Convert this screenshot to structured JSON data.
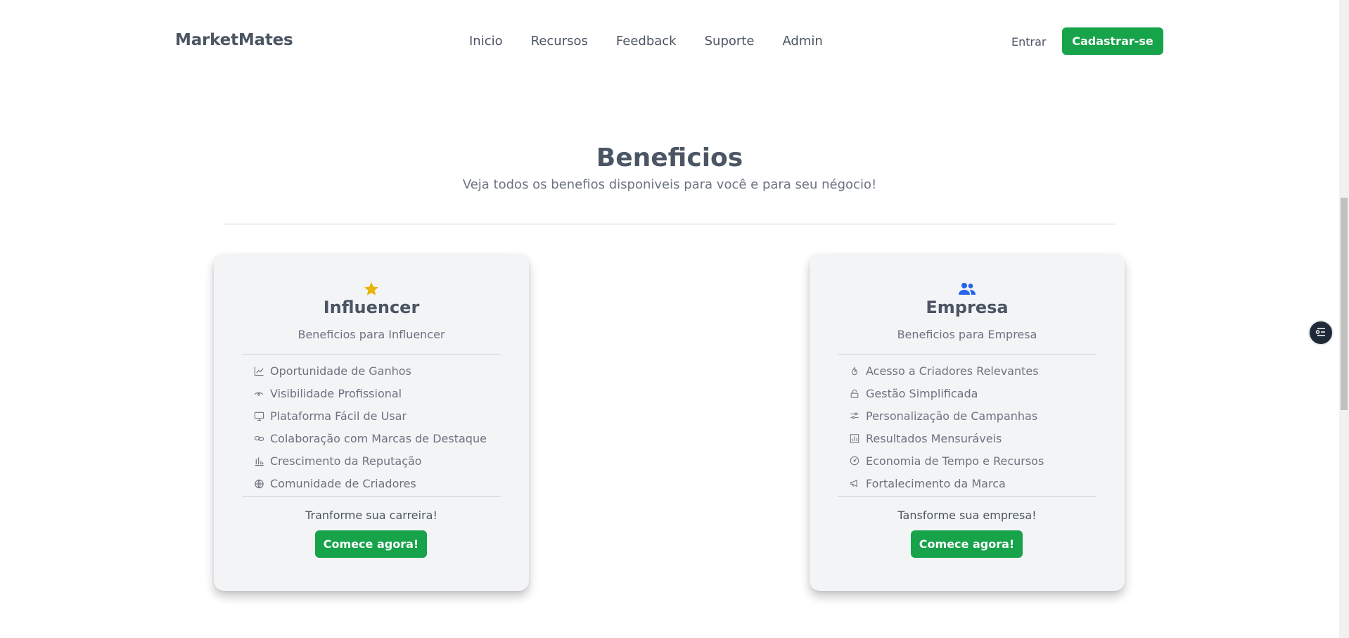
{
  "header": {
    "brand": "MarketMates",
    "nav": [
      "Inicio",
      "Recursos",
      "Feedback",
      "Suporte",
      "Admin"
    ],
    "login_label": "Entrar",
    "signup_label": "Cadastrar-se"
  },
  "section": {
    "title": "Beneficios",
    "subtitle": "Veja todos os benefios disponiveis para você e para seu négocio!"
  },
  "cards": [
    {
      "icon": "star-icon",
      "title": "Influencer",
      "subtitle": "Beneficios para Influencer",
      "items": [
        {
          "icon": "line-chart-icon",
          "label": "Oportunidade de Ganhos"
        },
        {
          "icon": "eye-icon",
          "label": "Visibilidade Profissional"
        },
        {
          "icon": "monitor-icon",
          "label": "Plataforma Fácil de Usar"
        },
        {
          "icon": "link-icon",
          "label": "Colaboração com Marcas de Destaque"
        },
        {
          "icon": "bar-chart-icon",
          "label": "Crescimento da Reputação"
        },
        {
          "icon": "globe-icon",
          "label": "Comunidade de Criadores"
        }
      ],
      "cta_text": "Tranforme sua carreira!",
      "button_label": "Comece agora!"
    },
    {
      "icon": "users-icon",
      "title": "Empresa",
      "subtitle": "Beneficios para Empresa",
      "items": [
        {
          "icon": "flame-icon",
          "label": "Acesso a Criadores Relevantes"
        },
        {
          "icon": "lock-open-icon",
          "label": "Gestão Simplificada"
        },
        {
          "icon": "sliders-icon",
          "label": "Personalização de Campanhas"
        },
        {
          "icon": "bar-chart-icon",
          "label": "Resultados Mensuráveis"
        },
        {
          "icon": "gauge-icon",
          "label": "Economia de Tempo e Recursos"
        },
        {
          "icon": "megaphone-icon",
          "label": "Fortalecimento da Marca"
        }
      ],
      "cta_text": "Tansforme sua empresa!",
      "button_label": "Comece agora!"
    }
  ],
  "colors": {
    "accent_green": "#16a34a",
    "star_yellow": "#eab308",
    "users_blue": "#2563eb",
    "card_bg": "#f3f4f6",
    "text": "#4b5563"
  },
  "floating_button": {
    "icon": "menu-lines-icon"
  }
}
